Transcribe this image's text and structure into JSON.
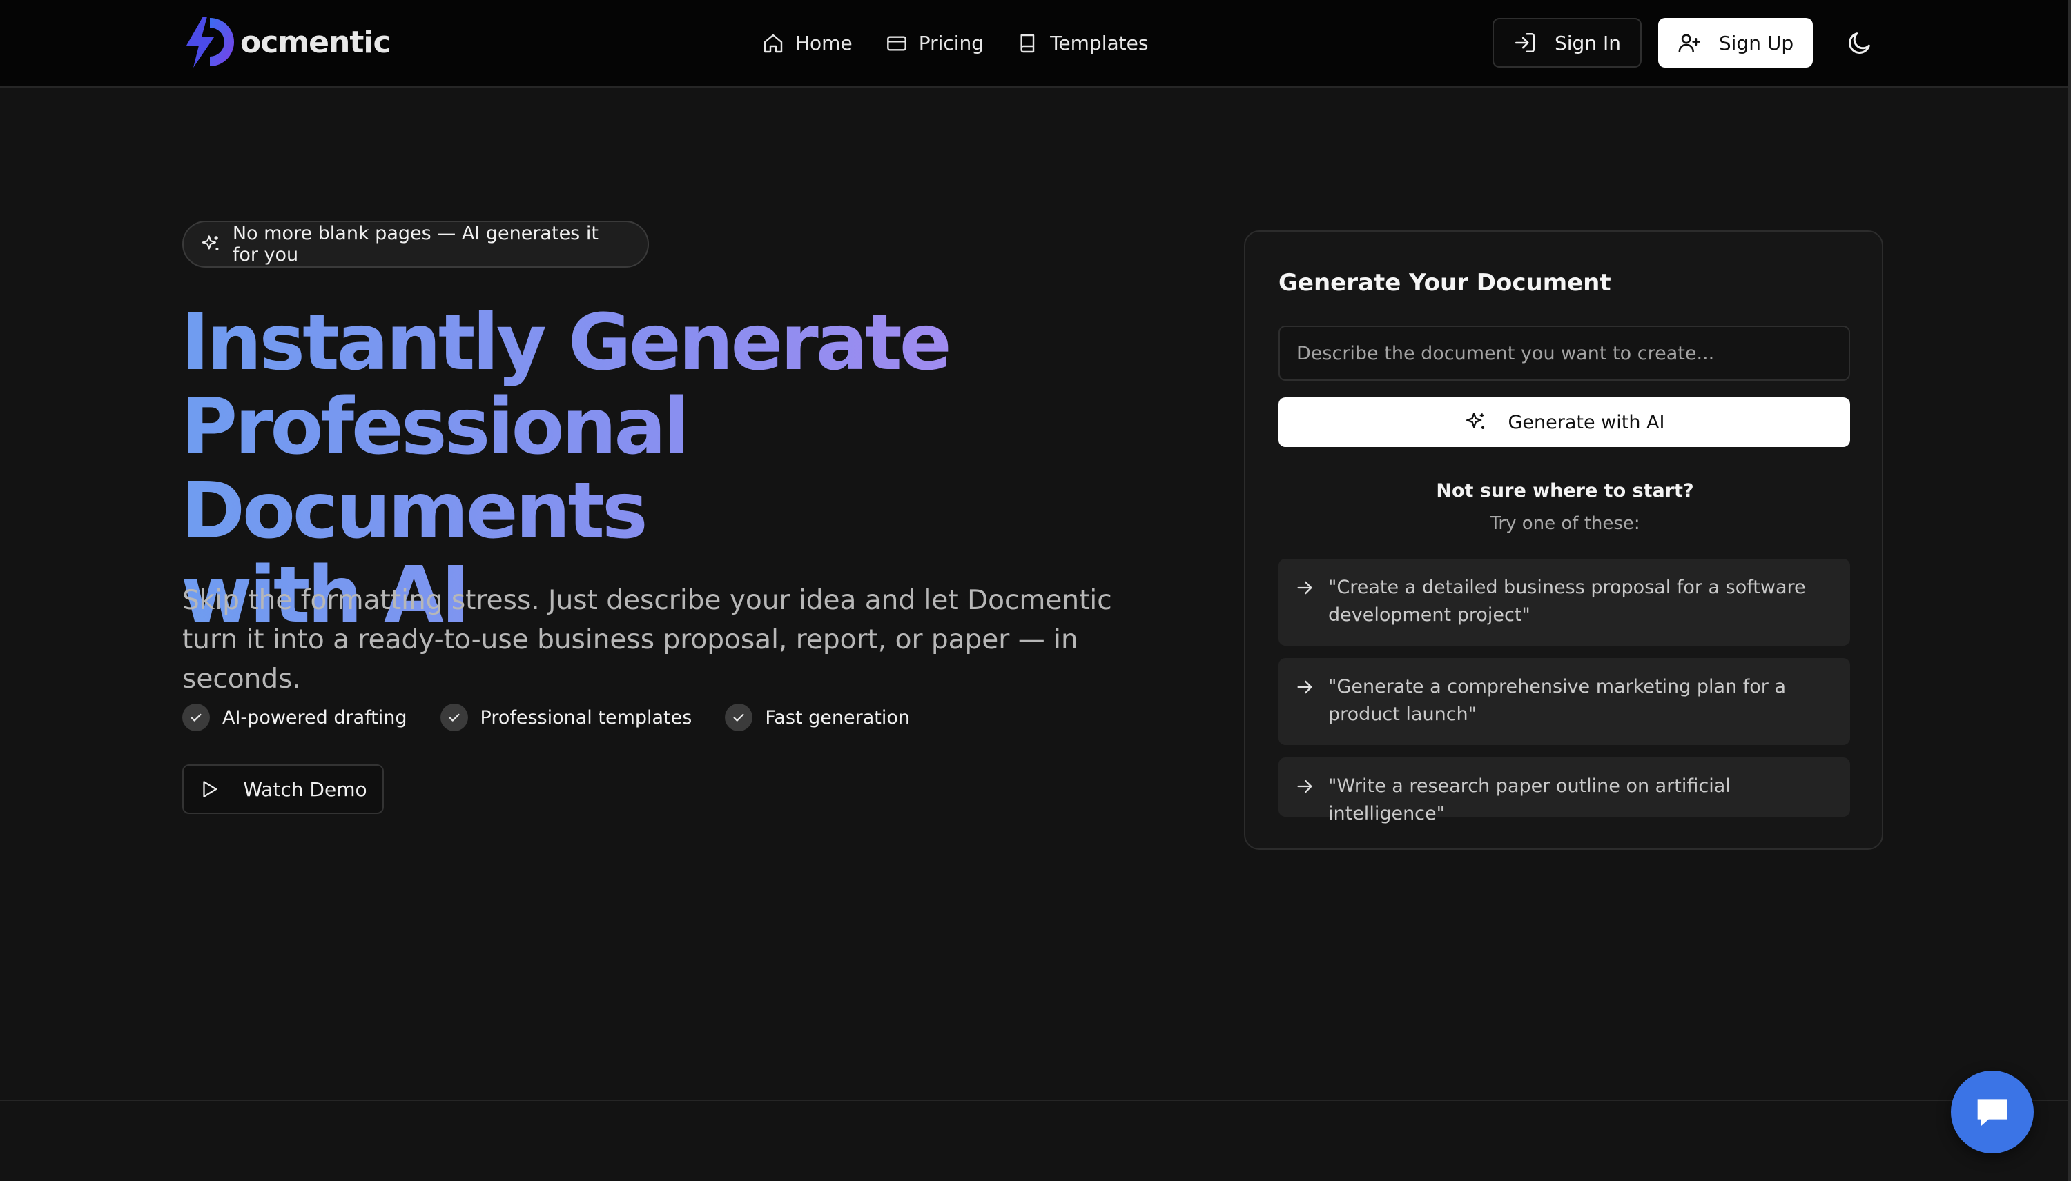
{
  "brand": {
    "name": "ocmentic",
    "accent": "#7b5cf0"
  },
  "nav": {
    "links": [
      {
        "label": "Home",
        "icon": "home-icon"
      },
      {
        "label": "Pricing",
        "icon": "credit-card-icon"
      },
      {
        "label": "Templates",
        "icon": "book-icon"
      }
    ],
    "sign_in": "Sign In",
    "sign_up": "Sign Up",
    "theme_icon": "moon-icon"
  },
  "hero": {
    "badge": "No more blank pages — AI generates it for you",
    "title_line1": "Instantly Generate",
    "title_line2": "Professional Documents",
    "title_line3": "with AI",
    "subtitle": "Skip the formatting stress. Just describe your idea and let Docmentic turn it into a ready-to-use business proposal, report, or paper — in seconds.",
    "features": [
      "AI-powered drafting",
      "Professional templates",
      "Fast generation"
    ],
    "demo_button": "Watch Demo"
  },
  "generator": {
    "title": "Generate Your Document",
    "input_placeholder": "Describe the document you want to create...",
    "generate_button": "Generate with AI",
    "hint_title": "Not sure where to start?",
    "hint_sub": "Try one of these:",
    "suggestions": [
      "\"Create a detailed business proposal for a software development project\"",
      "\"Generate a comprehensive marketing plan for a product launch\"",
      "\"Write a research paper outline on artificial intelligence\""
    ]
  },
  "colors": {
    "background": "#131313",
    "nav_background": "#050505",
    "title_gradient_start": "#6f9cf0",
    "title_gradient_end": "#b18af0",
    "chat_button": "#3b74e6"
  }
}
